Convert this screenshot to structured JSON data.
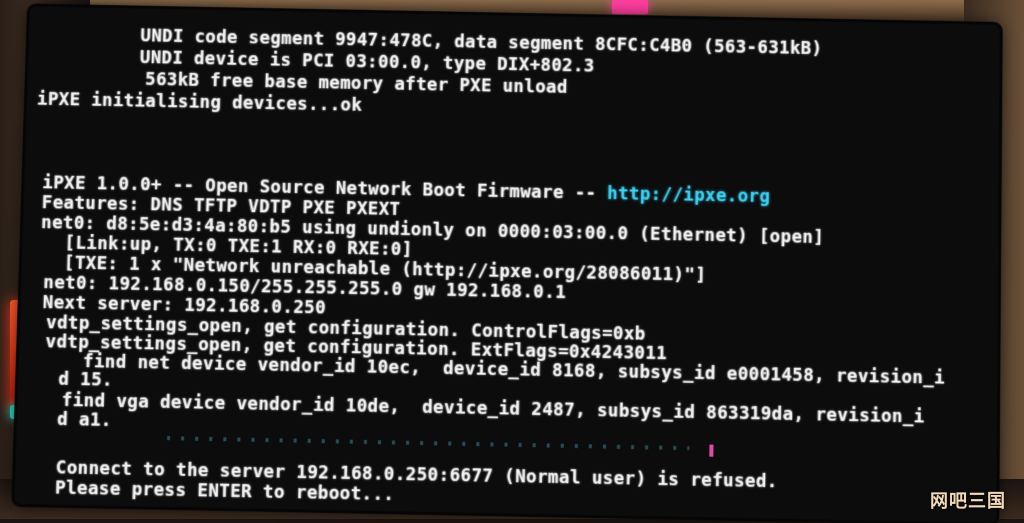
{
  "screen": {
    "lines": [
      "UNDI code segment 9947:478C, data segment 8CFC:C4B0 (563-631kB)",
      "UNDI device is PCI 03:00.0, type DIX+802.3",
      "563kB free base memory after PXE unload",
      "iPXE initialising devices...ok",
      "iPXE 1.0.0+ -- Open Source Network Boot Firmware -- ",
      "Features: DNS TFTP VDTP PXE PXEXT",
      "net0: d8:5e:d3:4a:80:b5 using undionly on 0000:03:00.0 (Ethernet) [open]",
      "[Link:up, TX:0 TXE:1 RX:0 RXE:0]",
      "[TXE: 1 x \"Network unreachable (http://ipxe.org/28086011)\"]",
      "net0: 192.168.0.150/255.255.255.0 gw 192.168.0.1",
      "Next server: 192.168.0.250",
      "vdtp_settings_open, get configuration. ControlFlags=0xb",
      "vdtp_settings_open, get configuration. ExtFlags=0x4243011",
      "find net device vendor_id 10ec,  device_id 8168, subsys_id e0001458, revision_i",
      "d 15.",
      "find vga device vendor_id 10de,  device_id 2487, subsys_id 863319da, revision_i",
      "d a1.",
      "Connect to the server 192.168.0.250:6677 (Normal user) is refused.",
      "Please press ENTER to reboot..."
    ],
    "url": "http://ipxe.org"
  },
  "watermark": "网吧三国",
  "colors": {
    "screen_bg": "#0c0c0c",
    "text": "#f2f2f2",
    "url": "#3fd0f0"
  }
}
